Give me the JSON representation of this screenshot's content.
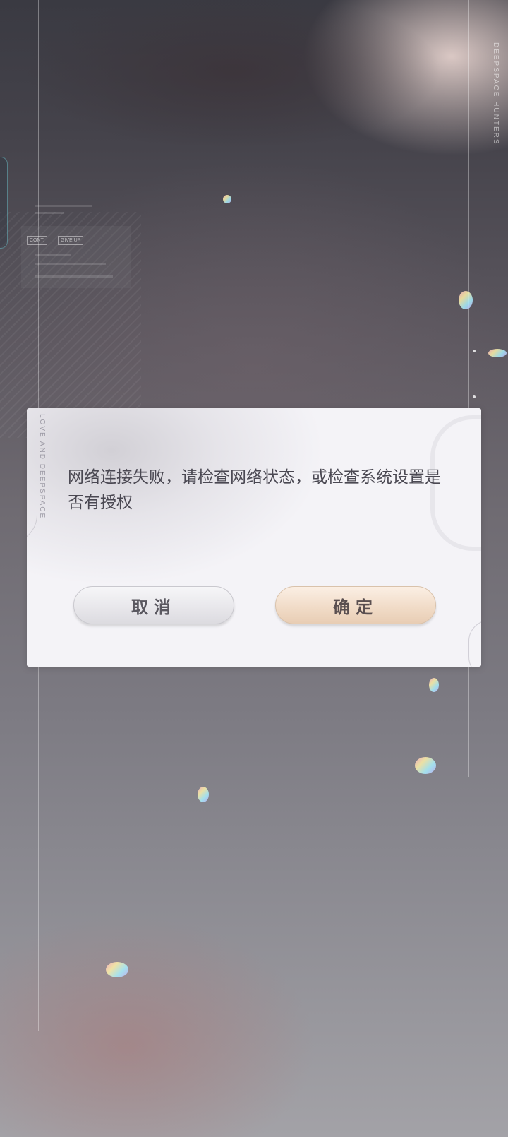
{
  "background": {
    "brand_text": "DEEPSPACE HUNTERS",
    "hud": {
      "button_1": "CONT.",
      "button_2": "GIVE UP"
    }
  },
  "dialog": {
    "side_text": "LOVE AND DEEPSPACE",
    "message": "网络连接失败，请检查网络状态，或检查系统设置是否有授权",
    "cancel_label": "取消",
    "confirm_label": "确定"
  },
  "colors": {
    "dialog_bg": "#f4f3f7",
    "message_text": "#4a4852",
    "confirm_button": "#f1dcc8",
    "cancel_button": "#e7e6ea"
  }
}
